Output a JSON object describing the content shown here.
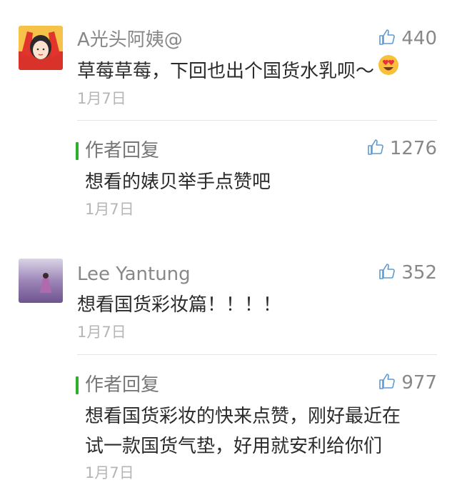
{
  "comments": [
    {
      "name": "A光头阿姨@",
      "likes": "440",
      "text": "草莓草莓，下回也出个国货水乳呗～",
      "emoji": "heart-eyes-emoji",
      "date": "1月7日",
      "reply": {
        "label": "作者回复",
        "likes": "1276",
        "lines": [
          "想看的婊贝举手点赞吧"
        ],
        "date": "1月7日"
      }
    },
    {
      "name": "Lee Yantung",
      "likes": "352",
      "text": "想看国货彩妆篇！！！！",
      "date": "1月7日",
      "reply": {
        "label": "作者回复",
        "likes": "977",
        "lines": [
          "想看国货彩妆的快来点赞，刚好最近在",
          "试一款国货气垫，好用就安利给你们"
        ],
        "date": "1月7日"
      }
    }
  ],
  "colors": {
    "reply_bar": "#2bb02b",
    "like_icon": "#5a9bd5"
  }
}
